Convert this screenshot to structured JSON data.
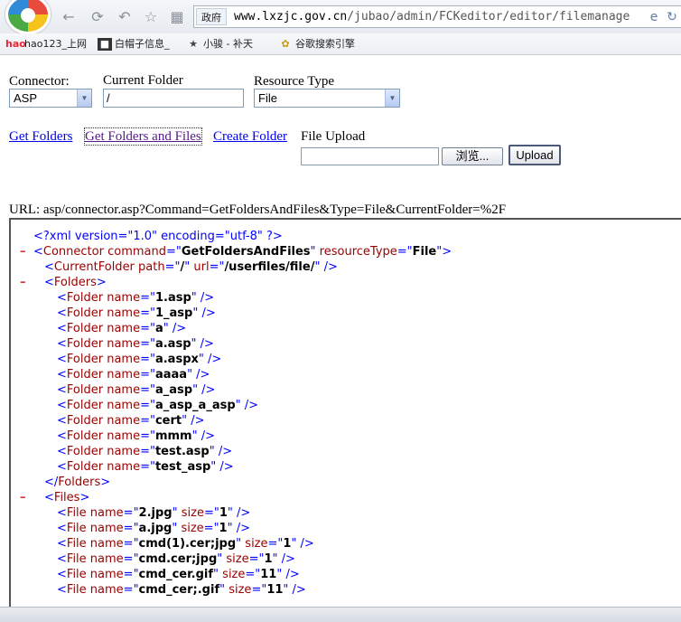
{
  "browser": {
    "zone_label": "政府",
    "url_host": "www.lxzjc.gov.cn",
    "url_path": "/jubao/admin/FCKeditor/editor/filemanage",
    "bookmarks": [
      {
        "icon": "hao123-icon",
        "label": "hao123_上网"
      },
      {
        "icon": "page-icon",
        "label": "白帽子信息_"
      },
      {
        "icon": "star-icon",
        "label": "小骏 - 补天"
      },
      {
        "icon": "google-icon",
        "label": "谷歌搜索引擎"
      }
    ]
  },
  "form": {
    "connector_label": "Connector:",
    "connector_value": "ASP",
    "current_folder_label": "Current Folder",
    "current_folder_value": "/",
    "resource_type_label": "Resource Type",
    "resource_type_value": "File",
    "get_folders": "Get Folders",
    "get_folders_and_files": "Get Folders and Files",
    "create_folder": "Create Folder",
    "file_upload_label": "File Upload",
    "browse_button": "浏览...",
    "upload_button": "Upload"
  },
  "url_line": "URL: asp/connector.asp?Command=GetFoldersAndFiles&Type=File&CurrentFolder=%2F",
  "xml": {
    "declaration": "<?xml version=\"1.0\" encoding=\"utf-8\" ?>",
    "connector": {
      "command": "GetFoldersAndFiles",
      "resourceType": "File"
    },
    "current_folder": {
      "path": "/",
      "url": "/userfiles/file/"
    },
    "folders": [
      "1.asp",
      "1_asp",
      "a",
      "a.asp",
      "a.aspx",
      "aaaa",
      "a_asp",
      "a_asp_a_asp",
      "cert",
      "mmm",
      "test.asp",
      "test_asp"
    ],
    "files": [
      {
        "name": "2.jpg",
        "size": "1"
      },
      {
        "name": "a.jpg",
        "size": "1"
      },
      {
        "name": "cmd(1).cer;jpg",
        "size": "1"
      },
      {
        "name": "cmd.cer;jpg",
        "size": "1"
      },
      {
        "name": "cmd_cer.gif",
        "size": "11"
      },
      {
        "name": "cmd_cer;.gif",
        "size": "11"
      }
    ]
  }
}
